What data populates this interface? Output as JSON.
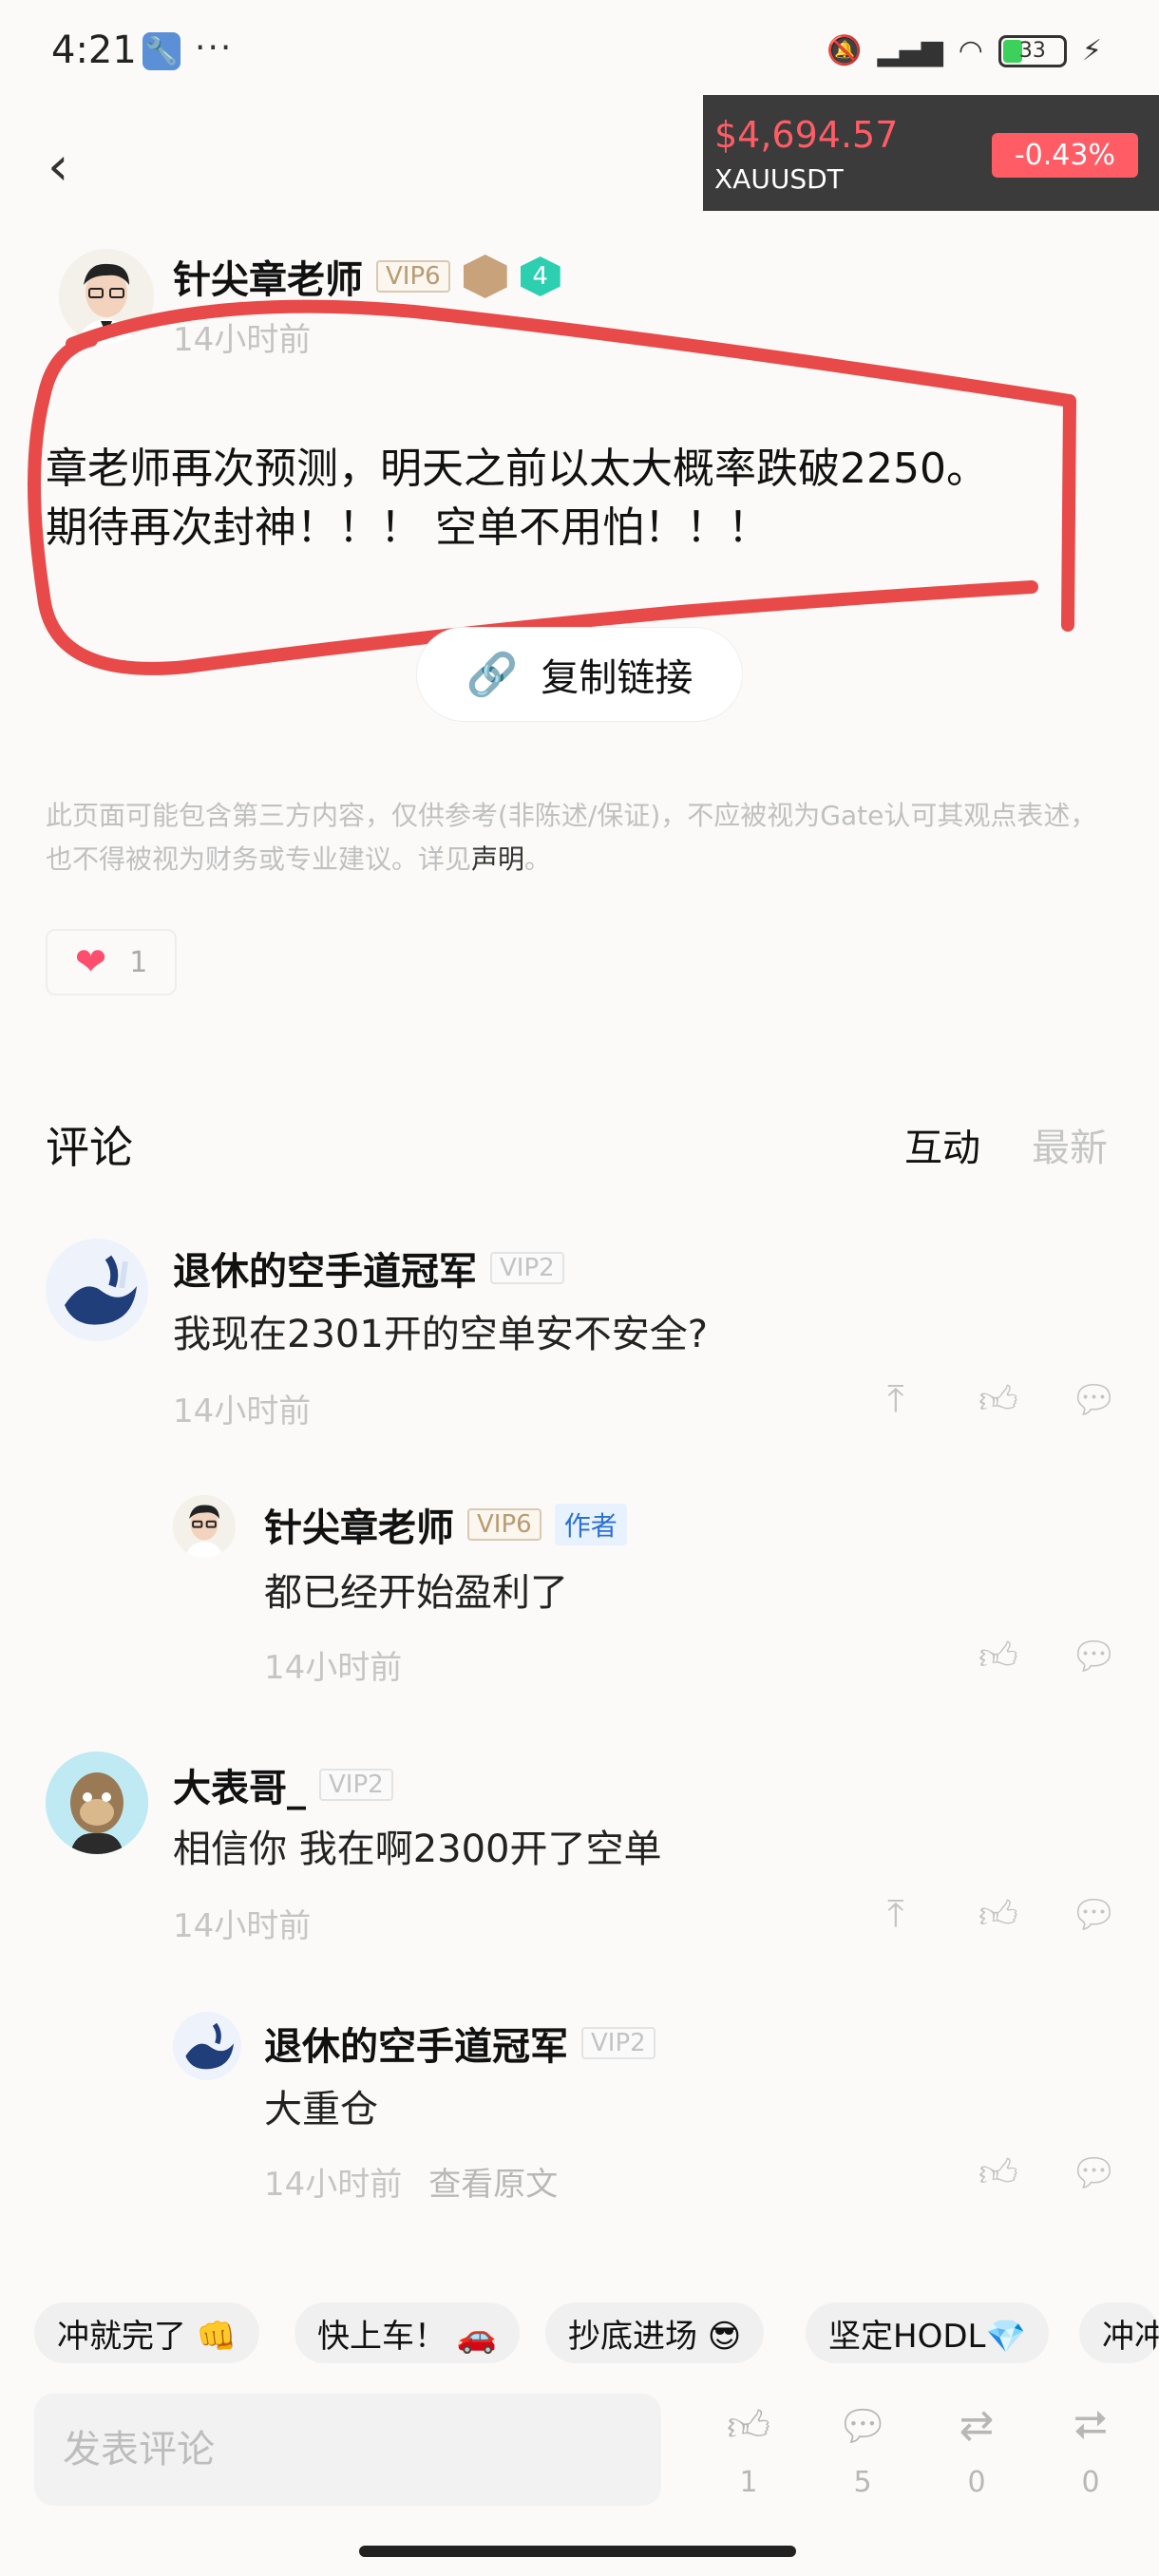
{
  "status_bar": {
    "time": "4:21",
    "dots": "···",
    "battery": "33"
  },
  "price": {
    "value": "$4,694.57",
    "pair": "XAUUSDT",
    "change": "-0.43%"
  },
  "post": {
    "author": "针尖章老师",
    "vip": "VIP6",
    "level": "4",
    "time": "14小时前",
    "line1": "章老师再次预测，明天之前以太大概率跌破2250。",
    "line2": "期待再次封神！！！ 空单不用怕！！！",
    "copy_link": "复制链接",
    "disclaimer": "此页面可能包含第三方内容，仅供参考(非陈述/保证)，不应被视为Gate认可其观点表述，也不得被视为财务或专业建议。详见",
    "disclaimer_link": "声明",
    "disclaimer_end": "。",
    "likes": "1"
  },
  "comments_section": {
    "title": "评论",
    "tab_interactive": "互动",
    "tab_latest": "最新",
    "items": [
      {
        "name": "退休的空手道冠军",
        "vip": "VIP2",
        "text": "我现在2301开的空单安不安全?",
        "time": "14小时前"
      },
      {
        "name": "针尖章老师",
        "vip": "VIP6",
        "author_tag": "作者",
        "text": "都已经开始盈利了",
        "time": "14小时前"
      },
      {
        "name": "大表哥_",
        "vip": "VIP2",
        "text": "相信你  我在啊2300开了空单",
        "time": "14小时前"
      },
      {
        "name": "退休的空手道冠军",
        "vip": "VIP2",
        "text": "大重仓",
        "time": "14小时前",
        "view_original": "查看原文"
      }
    ]
  },
  "chips": [
    "冲就完了 👊",
    "快上车！ 🚗",
    "抄底进场 😎",
    "坚定HODL💎",
    "冲冲"
  ],
  "bottom_bar": {
    "placeholder": "发表评论",
    "like_count": "1",
    "comment_count": "5",
    "repost_count": "0",
    "share_count": "0"
  },
  "colors": {
    "price_red": "#ff5c66",
    "annotation": "#e84a4a",
    "heart": "#ff4d6d"
  }
}
